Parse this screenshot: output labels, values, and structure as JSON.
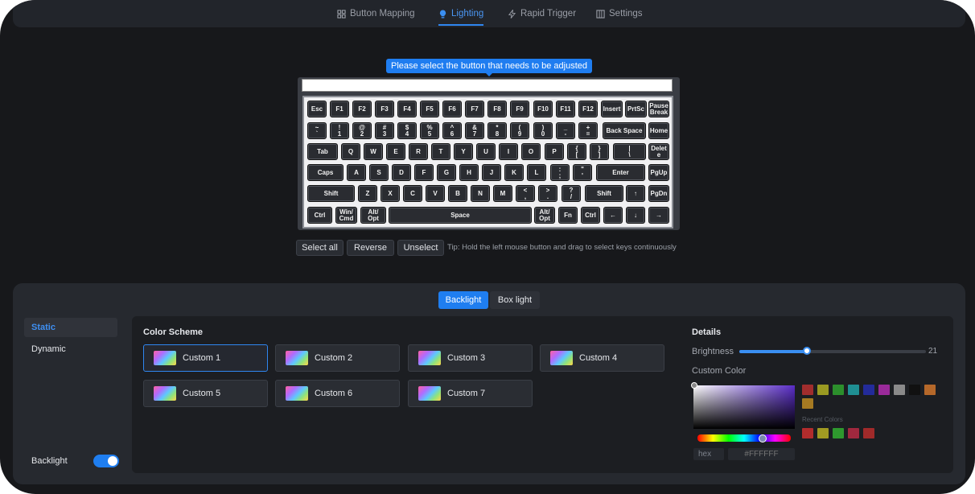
{
  "nav": {
    "tabs": [
      {
        "label": "Button Mapping",
        "icon": "button-mapping-icon"
      },
      {
        "label": "Lighting",
        "icon": "bulb-icon"
      },
      {
        "label": "Rapid Trigger",
        "icon": "lightning-icon"
      },
      {
        "label": "Settings",
        "icon": "settings-grid-icon"
      }
    ],
    "active": "Lighting"
  },
  "tooltip": "Please select the button that needs to be adjusted",
  "keyboard": {
    "rows": [
      [
        "Esc",
        "F1",
        "F2",
        "F3",
        "F4",
        "F5",
        "F6",
        "F7",
        "F8",
        "F9",
        "F10",
        "F11",
        "F12",
        "Insert",
        "PrtSc",
        "Pause\nBreak"
      ],
      [
        "~\n`",
        "!\n1",
        "@\n2",
        "#\n3",
        "$\n4",
        "%\n5",
        "^\n6",
        "&\n7",
        "*\n8",
        "(\n9",
        ")\n0",
        "_\n-",
        "+\n=",
        "Back Space",
        "Home"
      ],
      [
        "Tab",
        "Q",
        "W",
        "E",
        "R",
        "T",
        "Y",
        "U",
        "I",
        "O",
        "P",
        "{\n[",
        "}\n]",
        "|\n\\",
        "Delet\ne"
      ],
      [
        "Caps",
        "A",
        "S",
        "D",
        "F",
        "G",
        "H",
        "J",
        "K",
        "L",
        ":\n;",
        "\"\n'",
        "Enter",
        "PgUp"
      ],
      [
        "Shift",
        "Z",
        "X",
        "C",
        "V",
        "B",
        "N",
        "M",
        "<\n,",
        ">\n.",
        "?\n/",
        "Shift",
        "↑",
        "PgDn"
      ],
      [
        "Ctrl",
        "Win/\nCmd",
        "Alt/\nOpt",
        "Space",
        "Alt/\nOpt",
        "Fn",
        "Ctrl",
        "←",
        "↓",
        "→"
      ]
    ]
  },
  "selection": {
    "select_all": "Select all",
    "reverse": "Reverse",
    "unselect": "Unselect",
    "tip": "Tip: Hold the left mouse button and drag to select keys continuously"
  },
  "light_tabs": {
    "backlight": "Backlight",
    "box_light": "Box light"
  },
  "sidebar": {
    "items": [
      {
        "label": "Static"
      },
      {
        "label": "Dynamic"
      }
    ],
    "backlight_label": "Backlight",
    "backlight_on": true
  },
  "scheme": {
    "title": "Color Scheme",
    "cards": [
      "Custom 1",
      "Custom 2",
      "Custom 3",
      "Custom 4",
      "Custom 5",
      "Custom 6",
      "Custom 7"
    ],
    "selected": "Custom 1"
  },
  "details": {
    "title": "Details",
    "brightness_label": "Brightness",
    "brightness_value": "21",
    "brightness_fraction": 0.36,
    "custom_color_label": "Custom Color",
    "format": "hex",
    "hex_placeholder": "#FFFFFF",
    "recent_label": "Recent Colors",
    "palette": [
      "#a12d2d",
      "#9a9a22",
      "#2c8f2c",
      "#1f8f93",
      "#232b9a",
      "#9a2a9a",
      "#8a8a8a",
      "#111111",
      "#b5682a",
      "#a67a22"
    ],
    "recent": [
      "#b22c2c",
      "#a09a22",
      "#2e982e",
      "#a0283e",
      "#a02a2a"
    ]
  }
}
